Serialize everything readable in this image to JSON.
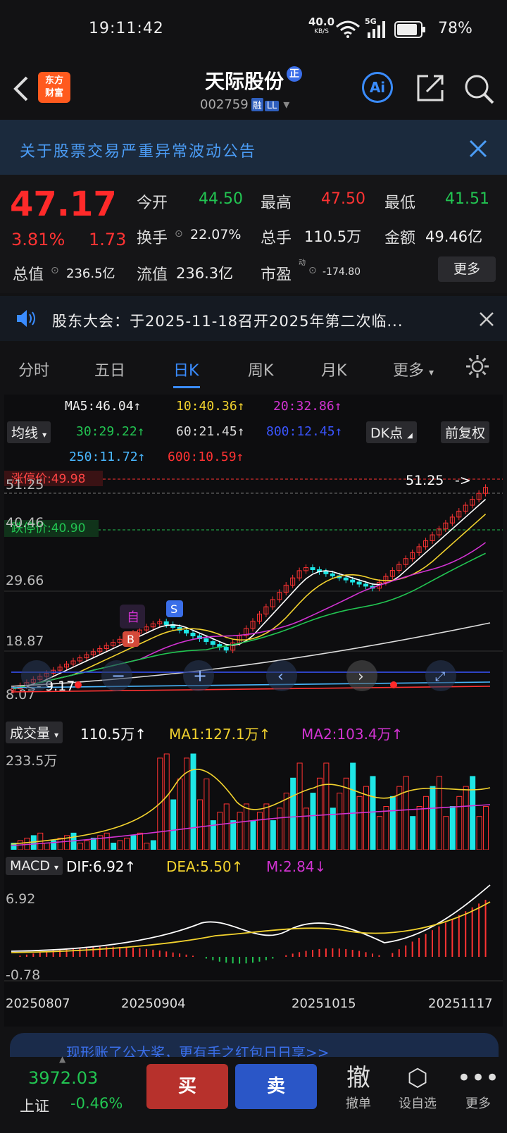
{
  "status": {
    "time": "19:11:42",
    "speed": "40.0",
    "speed_unit": "KB/S",
    "network": "5G",
    "battery": "78%"
  },
  "header": {
    "title": "天际股份",
    "title_badge": "正",
    "code": "002759",
    "tag1": "融",
    "tag2": "LL",
    "logo_line1": "东方",
    "logo_line2": "财富",
    "ai_label": "Ai"
  },
  "notice": {
    "text": "关于股票交易严重异常波动公告"
  },
  "quote": {
    "price": "47.17",
    "pct": "3.81%",
    "change": "1.73",
    "open_label": "今开",
    "open": "44.50",
    "high_label": "最高",
    "high": "47.50",
    "low_label": "最低",
    "low": "41.51",
    "turnover_label": "换手",
    "turnover": "22.07%",
    "volume_label": "总手",
    "volume": "110.5万",
    "amount_label": "金额",
    "amount": "49.46亿",
    "mktcap_label": "总值",
    "mktcap": "236.5亿",
    "float_label": "流值",
    "float": "236.3亿",
    "pe_label": "市盈",
    "pe_sup": "动",
    "pe": "-174.80",
    "more": "更多"
  },
  "announce": {
    "text": "股东大会：于2025-11-18召开2025年第二次临..."
  },
  "tabs": [
    {
      "label": "分时"
    },
    {
      "label": "五日"
    },
    {
      "label": "日K"
    },
    {
      "label": "周K"
    },
    {
      "label": "月K"
    },
    {
      "label": "更多"
    }
  ],
  "ma": {
    "ma5": "MA5:46.04↑",
    "ma10": "10:40.36↑",
    "ma20": "20:32.86↑",
    "ma30": "30:29.22↑",
    "ma60": "60:21.45↑",
    "ma800": "800:12.45↑",
    "ma250": "250:11.72↑",
    "ma600": "600:10.59↑",
    "select": "均线",
    "dk": "DK点",
    "fq": "前复权"
  },
  "kline": {
    "limit_up": "涨停价:49.98",
    "limit_down": "跌停价:40.90",
    "y1": "51.25",
    "y2": "40.46",
    "y3": "29.66",
    "y4": "18.87",
    "y5": "8.07",
    "high_mark": "51.25",
    "low_mark": "9.17",
    "mark_b": "B",
    "mark_s": "S",
    "mark_zi": "自",
    "nine": "9"
  },
  "volume": {
    "select": "成交量",
    "v": "110.5万↑",
    "ma1": "MA1:127.1万↑",
    "ma2": "MA2:103.4万↑",
    "ymax": "233.5万"
  },
  "macd": {
    "select": "MACD",
    "dif": "DIF:6.92↑",
    "dea": "DEA:5.50↑",
    "m": "M:2.84↓",
    "ymax": "6.92",
    "ymin": "-0.78"
  },
  "dates": [
    "20250807",
    "20250904",
    "20251015",
    "20251117"
  ],
  "banner": {
    "text": "现形账了公大奖，更有手之红包日日享>>"
  },
  "bottom": {
    "index_value": "3972.03",
    "index_name": "上证",
    "index_pct": "-0.46%",
    "buy": "买",
    "sell": "卖",
    "cancel": "撤单",
    "cancel_icon": "撤",
    "alert": "设自选",
    "more": "更多"
  },
  "colors": {
    "up": "#ff3333",
    "down": "#22c552",
    "accent": "#3a8cff",
    "volume_down": "#1ee6e6"
  }
}
